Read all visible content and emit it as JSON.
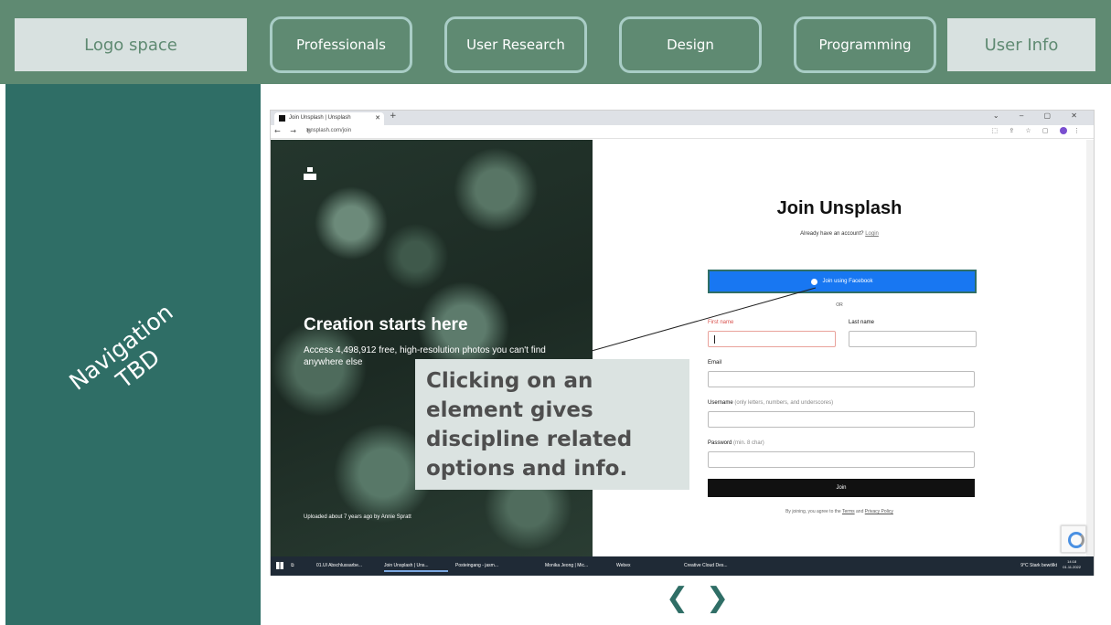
{
  "header": {
    "logo_label": "Logo space",
    "nav": [
      "Professionals",
      "User Research",
      "Design",
      "Programming"
    ],
    "user_info_label": "User Info"
  },
  "sidebar": {
    "label": "Navigation TBD"
  },
  "browser": {
    "tab_title": "Join Unsplash | Unsplash",
    "url": "unsplash.com/join",
    "photo": {
      "title": "Creation starts here",
      "subtitle": "Access 4,498,912 free, high-resolution photos you can't find anywhere else",
      "credit": "Uploaded about 7 years ago by Annie Spratt"
    },
    "form": {
      "title": "Join Unsplash",
      "subtitle_prefix": "Already have an account?",
      "login_link": "Login",
      "facebook_button": "Join using Facebook",
      "or_label": "OR",
      "first_name_label": "First name",
      "last_name_label": "Last name",
      "email_label": "Email",
      "username_label": "Username",
      "username_hint": "(only letters, numbers, and underscores)",
      "password_label": "Password",
      "password_hint": "(min. 8 char)",
      "join_button": "Join",
      "terms_prefix": "By joining, you agree to the",
      "terms_link": "Terms",
      "terms_and": "and",
      "privacy_link": "Privacy Policy"
    },
    "taskbar": {
      "items": [
        "01.UI Abschlussarbe...",
        "Join Unsplash | Uns...",
        "Posteingang - jasm...",
        "Monika Jeong | Mic...",
        "Webex",
        "Creative Cloud Des..."
      ],
      "weather": "9°C Stark bewölkt",
      "time": "14:18",
      "date": "01.11.2022"
    }
  },
  "annotation": {
    "text": "Clicking on an element gives discipline related options and info."
  },
  "pager": {
    "prev": "❮",
    "next": "❯"
  },
  "colors": {
    "header_bg": "#5f8a72",
    "sidebar_bg": "#2f6e66",
    "button_border": "#a9cdc6",
    "placeholder_box": "#d8e1e0",
    "callout_bg": "#dbe3e1"
  }
}
